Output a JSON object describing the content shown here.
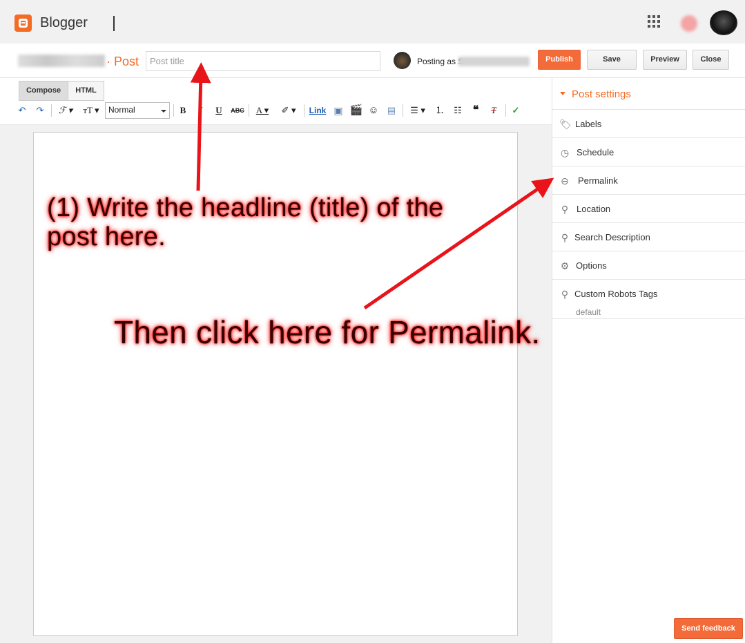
{
  "topbar": {
    "brand": "Blogger"
  },
  "postbar": {
    "crumb": "· Post",
    "title_placeholder": "Post title",
    "posting_as": "Posting as S",
    "buttons": {
      "publish": "Publish",
      "save": "Save",
      "preview": "Preview",
      "close": "Close"
    }
  },
  "editor": {
    "modes": [
      "Compose",
      "HTML"
    ],
    "format_select": "Normal",
    "link_label": "Link"
  },
  "sidebar": {
    "heading": "Post settings",
    "items": [
      {
        "label": "Labels",
        "icon": "tag-icon"
      },
      {
        "label": "Schedule",
        "icon": "clock-icon"
      },
      {
        "label": "Permalink",
        "icon": "link-icon"
      },
      {
        "label": "Location",
        "icon": "pin-icon"
      },
      {
        "label": "Search Description",
        "icon": "search-icon"
      },
      {
        "label": "Options",
        "icon": "gear-icon"
      },
      {
        "label": "Custom Robots Tags",
        "icon": "search-icon",
        "sub": "default"
      }
    ]
  },
  "feedback_label": "Send feedback",
  "annotations": {
    "step1": "(1) Write the headline (title) of the post here.",
    "step2": "Then click here for Permalink."
  },
  "colors": {
    "accent": "#f36b24",
    "arrow": "#e8141a"
  }
}
